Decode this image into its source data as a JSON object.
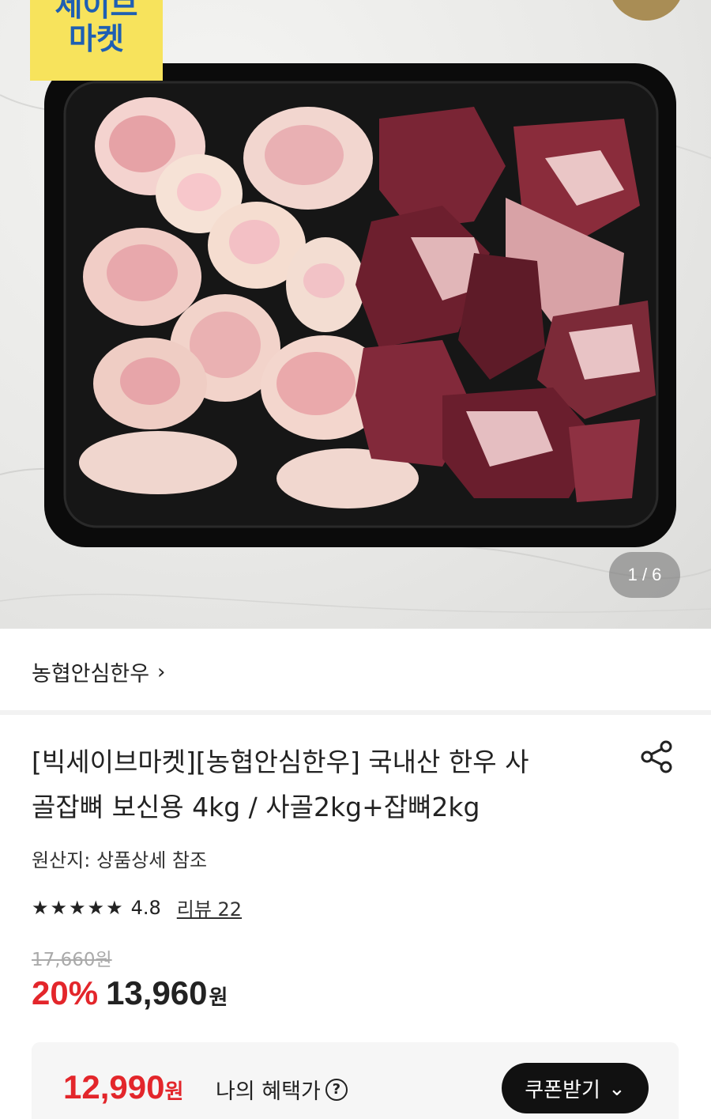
{
  "hero": {
    "badge_line1": "세이브",
    "badge_line2": "마켓",
    "image_counter": "1 / 6"
  },
  "store": {
    "name": "농협안심한우",
    "chevron": "›"
  },
  "product": {
    "title_line1": "[빅세이브마켓][농협안심한우] 국내산 한우 사",
    "title_line2": "골잡뼈 보신용 4kg / 사골2kg+잡뼈2kg",
    "origin": "원산지: 상품상세 참조",
    "rating": "4.8",
    "stars": 5,
    "review_link": "리뷰 22",
    "original_price": "17,660원",
    "discount": "20%",
    "price": "13,960",
    "price_unit": "원"
  },
  "benefit": {
    "price": "12,990",
    "price_unit": "원",
    "label": "나의 혜택가",
    "help": "?",
    "coupon_button": "쿠폰받기",
    "coupon_chevron": "⌄"
  },
  "colors": {
    "accent_red": "#e3262b",
    "badge_yellow": "#f7e35c",
    "badge_blue": "#1e5fb3"
  }
}
